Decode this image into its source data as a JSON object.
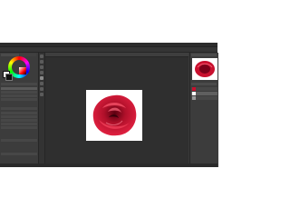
{
  "colors": {
    "app_bg": "#3a3a3a",
    "canvas_bg": "#2f2f2f",
    "paper": "#ffffff",
    "rose": "#c8102e"
  },
  "icons": [
    "color-wheel-icon",
    "brush-icon",
    "eraser-icon",
    "zoom-icon",
    "hand-icon",
    "layer-icon",
    "eye-icon"
  ],
  "canvas": {
    "subject": "rose-illustration"
  }
}
